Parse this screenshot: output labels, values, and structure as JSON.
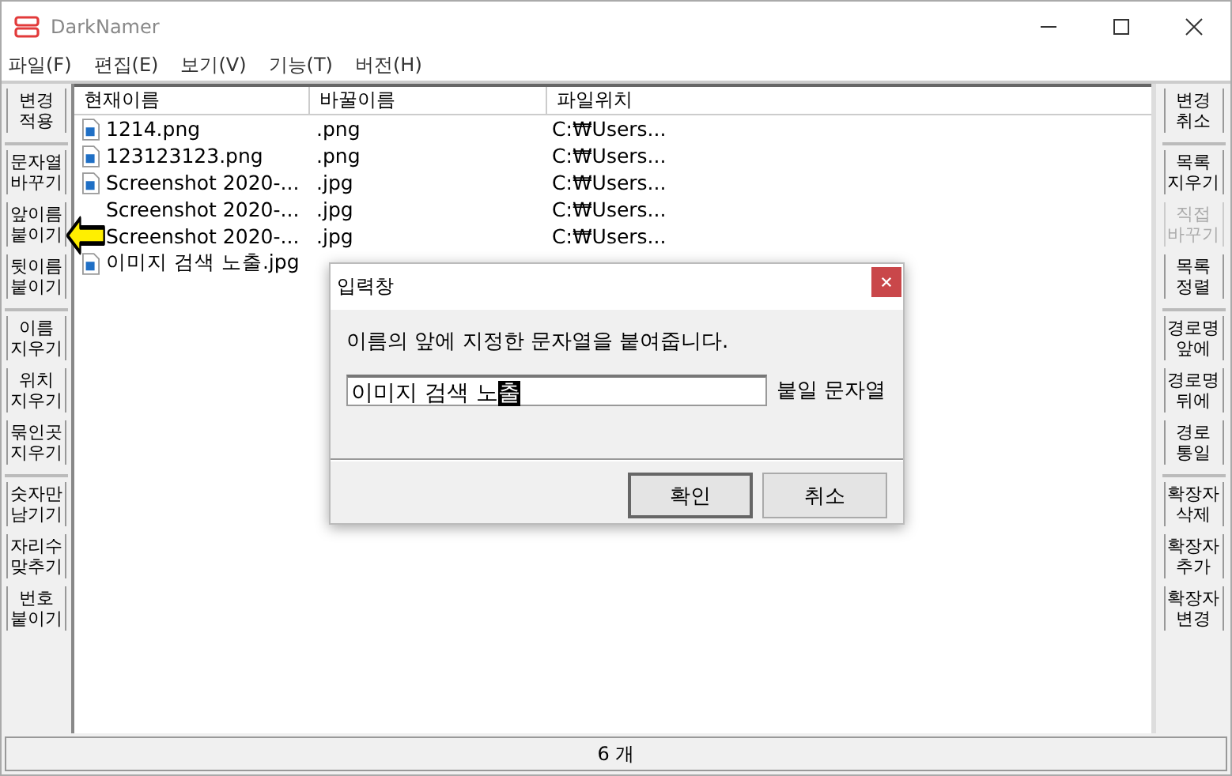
{
  "window": {
    "title": "DarkNamer"
  },
  "menu": [
    "파일(F)",
    "편집(E)",
    "보기(V)",
    "기능(T)",
    "버전(H)"
  ],
  "left_toolbar": [
    {
      "buttons": [
        {
          "label": "변경 적용",
          "disabled": false
        }
      ]
    },
    {
      "buttons": [
        {
          "label": "문자열 바꾸기",
          "disabled": false
        },
        {
          "label": "앞이름 붙이기",
          "disabled": false
        },
        {
          "label": "뒷이름 붙이기",
          "disabled": false
        }
      ]
    },
    {
      "buttons": [
        {
          "label": "이름 지우기",
          "disabled": false
        },
        {
          "label": "위치 지우기",
          "disabled": false
        },
        {
          "label": "묶인곳 지우기",
          "disabled": false
        }
      ]
    },
    {
      "buttons": [
        {
          "label": "숫자만 남기기",
          "disabled": false
        },
        {
          "label": "자리수 맞추기",
          "disabled": false
        },
        {
          "label": "번호 붙이기",
          "disabled": false
        }
      ]
    }
  ],
  "right_toolbar": [
    {
      "buttons": [
        {
          "label": "변경 취소",
          "disabled": false
        }
      ]
    },
    {
      "buttons": [
        {
          "label": "목록 지우기",
          "disabled": false
        },
        {
          "label": "직접 바꾸기",
          "disabled": true
        },
        {
          "label": "목록 정렬",
          "disabled": false
        }
      ]
    },
    {
      "buttons": [
        {
          "label": "경로명 앞에",
          "disabled": false
        },
        {
          "label": "경로명 뒤에",
          "disabled": false
        },
        {
          "label": "경로 통일",
          "disabled": false
        }
      ]
    },
    {
      "buttons": [
        {
          "label": "확장자 삭제",
          "disabled": false
        },
        {
          "label": "확장자 추가",
          "disabled": false
        },
        {
          "label": "확장자 변경",
          "disabled": false
        }
      ]
    }
  ],
  "table": {
    "columns": [
      "현재이름",
      "바꿀이름",
      "파일위치"
    ],
    "rows": [
      {
        "icon": true,
        "name": "1214.png",
        "new_name": ".png",
        "location": "C:₩Users..."
      },
      {
        "icon": true,
        "name": "123123123.png",
        "new_name": ".png",
        "location": "C:₩Users..."
      },
      {
        "icon": true,
        "name": "Screenshot 2020-...",
        "new_name": ".jpg",
        "location": "C:₩Users..."
      },
      {
        "icon": false,
        "name": "Screenshot 2020-...",
        "new_name": ".jpg",
        "location": "C:₩Users..."
      },
      {
        "icon": false,
        "name": "Screenshot 2020-...",
        "new_name": ".jpg",
        "location": "C:₩Users..."
      },
      {
        "icon": true,
        "name": "이미지 검색 노출.jpg"
      }
    ]
  },
  "status_bar": "6 개",
  "dialog": {
    "title": "입력창",
    "message": "이름의 앞에 지정한 문자열을 붙여줍니다.",
    "field": {
      "value": "이미지 검색 노",
      "composing": "출"
    },
    "field_label": "붙일 문자열",
    "buttons": [
      "확인",
      "취소"
    ]
  }
}
